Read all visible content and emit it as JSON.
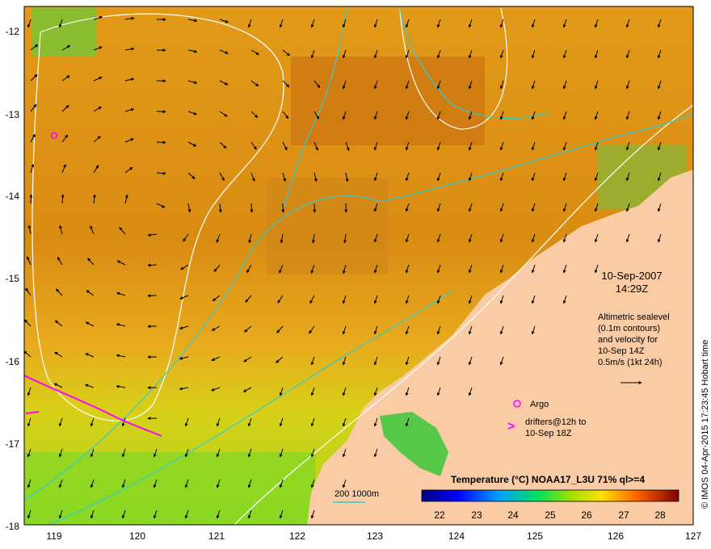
{
  "map": {
    "lon_ticks": [
      "119",
      "120",
      "121",
      "122",
      "123",
      "124",
      "125",
      "126",
      "127"
    ],
    "lat_ticks": [
      "-12",
      "-13",
      "-14",
      "-15",
      "-16",
      "-17",
      "-18"
    ],
    "lon_range": [
      118.6,
      127.0
    ],
    "lat_range": [
      -18.0,
      -11.8
    ]
  },
  "annotations": {
    "date": "10-Sep-2007",
    "time": "14:29Z",
    "altimetry_lines": [
      "Altimetric sealevel",
      "(0.1m contours)",
      "and velocity for",
      "10-Sep 14Z",
      "0.5m/s (1kt 24h)"
    ],
    "argo_label": "Argo",
    "drifters_lines": [
      "drifters@12h to",
      "10-Sep 18Z"
    ],
    "bathy_label": "200  1000m"
  },
  "colorbar": {
    "title": "Temperature (°C) NOAA17_L3U 71% ql>=4",
    "ticks": [
      "22",
      "23",
      "24",
      "25",
      "26",
      "27",
      "28"
    ],
    "range": [
      21.5,
      28.5
    ]
  },
  "credit": "© IMOS 04-Apr-2015 17:23:45 Hobart time",
  "colors": {
    "land": "#f9cca5",
    "sea_warm": "#e9a21a",
    "sea_cool": "#b9df18",
    "argo_marker": "#ff00ff",
    "drifter": "#ff00ff",
    "bathymetry": "#33cccc",
    "sealevel_contour": "#ffffff"
  }
}
